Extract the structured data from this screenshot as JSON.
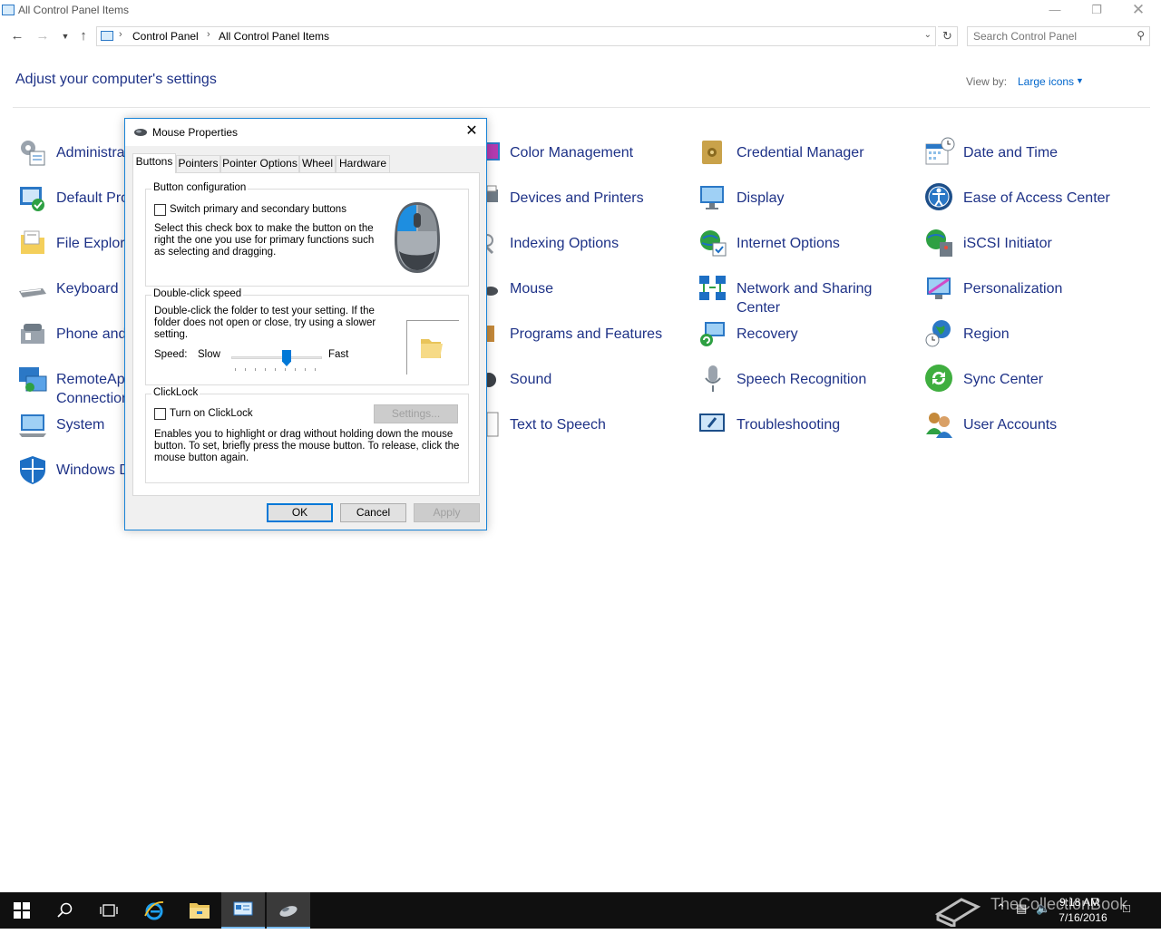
{
  "window": {
    "title": "All Control Panel Items"
  },
  "nav": {
    "breadcrumb": [
      "Control Panel",
      "All Control Panel Items"
    ],
    "search_placeholder": "Search Control Panel"
  },
  "header": {
    "title": "Adjust your computer's settings",
    "view_by_label": "View by:",
    "view_by_value": "Large icons"
  },
  "items": [
    {
      "label": "Administrative Tools",
      "icon": "admin-tools-icon"
    },
    {
      "label": "Default Programs",
      "icon": "default-programs-icon"
    },
    {
      "label": "File Explorer Options",
      "icon": "folder-options-icon"
    },
    {
      "label": "Keyboard",
      "icon": "keyboard-icon"
    },
    {
      "label": "Phone and Modem",
      "icon": "phone-modem-icon"
    },
    {
      "label": "RemoteApp and Desktop Connections",
      "label_line1": "RemoteApp",
      "label_line2": "Connection",
      "icon": "remoteapp-icon"
    },
    {
      "label": "System",
      "icon": "system-icon"
    },
    {
      "label": "Windows Defender",
      "icon": "defender-icon"
    },
    {
      "label": "Color Management",
      "icon": "color-management-icon"
    },
    {
      "label": "Devices and Printers",
      "icon": "devices-printers-icon"
    },
    {
      "label": "Indexing Options",
      "icon": "indexing-icon"
    },
    {
      "label": "Mouse",
      "icon": "mouse-icon"
    },
    {
      "label": "Programs and Features",
      "icon": "programs-features-icon"
    },
    {
      "label": "Sound",
      "icon": "sound-icon"
    },
    {
      "label": "Text to Speech",
      "icon": "text-to-speech-icon"
    },
    {
      "label": "Credential Manager",
      "icon": "credential-manager-icon"
    },
    {
      "label": "Display",
      "icon": "display-icon"
    },
    {
      "label": "Internet Options",
      "icon": "internet-options-icon"
    },
    {
      "label": "Network and Sharing Center",
      "label_line1": "Network and Sharing",
      "label_line2": "Center",
      "icon": "network-sharing-icon"
    },
    {
      "label": "Recovery",
      "icon": "recovery-icon"
    },
    {
      "label": "Speech Recognition",
      "icon": "microphone-icon"
    },
    {
      "label": "Troubleshooting",
      "icon": "troubleshooting-icon"
    },
    {
      "label": "Date and Time",
      "icon": "calendar-clock-icon"
    },
    {
      "label": "Ease of Access Center",
      "icon": "ease-of-access-icon"
    },
    {
      "label": "iSCSI Initiator",
      "icon": "iscsi-icon"
    },
    {
      "label": "Personalization",
      "icon": "personalization-icon"
    },
    {
      "label": "Region",
      "icon": "region-icon"
    },
    {
      "label": "Sync Center",
      "icon": "sync-center-icon"
    },
    {
      "label": "User Accounts",
      "icon": "user-accounts-icon"
    }
  ],
  "visible_labels": {
    "admin": "Administra",
    "default": "Default Pro",
    "file": "File Explore",
    "keyboard": "Keyboard",
    "phone": "Phone and",
    "remote1": "RemoteApp",
    "remote2": "Connection",
    "system": "System",
    "defender": "Windows D"
  },
  "dialog": {
    "title": "Mouse Properties",
    "tabs": [
      "Buttons",
      "Pointers",
      "Pointer Options",
      "Wheel",
      "Hardware"
    ],
    "button_config": {
      "title": "Button configuration",
      "checkbox_label": "Switch primary and secondary buttons",
      "checked": false,
      "desc1": "Select this check box to make the button on the",
      "desc2": "right the one you use for primary functions such",
      "desc3": "as selecting and dragging."
    },
    "double_click": {
      "title": "Double-click speed",
      "desc1": "Double-click the folder to test your setting. If the",
      "desc2": "folder does not open or close, try using a slower",
      "desc3": "setting.",
      "speed_label": "Speed:",
      "slow": "Slow",
      "fast": "Fast",
      "value_fraction": 0.6
    },
    "clicklock": {
      "title": "ClickLock",
      "checkbox_label": "Turn on ClickLock",
      "checked": false,
      "settings_button": "Settings...",
      "desc1": "Enables you to highlight or drag without holding down the mouse",
      "desc2": "button. To set, briefly press the mouse button. To release, click the",
      "desc3": "mouse button again."
    },
    "buttons": {
      "ok": "OK",
      "cancel": "Cancel",
      "apply": "Apply"
    }
  },
  "taskbar": {
    "time": "9:18 AM",
    "date": "7/16/2016",
    "watermark": "TheCollectionBook"
  },
  "colors": {
    "link": "#1e3287",
    "accent": "#0078d7",
    "taskbar": "#101010"
  }
}
